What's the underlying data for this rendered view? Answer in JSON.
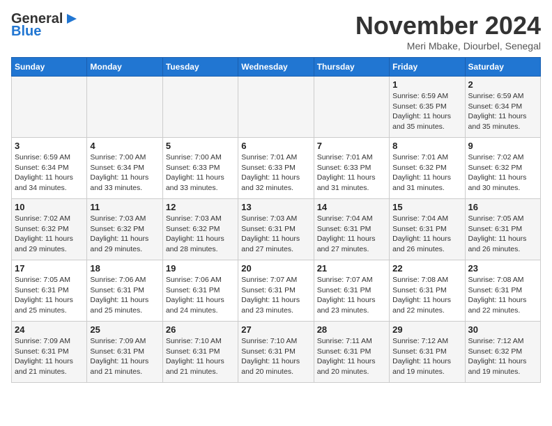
{
  "header": {
    "logo_general": "General",
    "logo_blue": "Blue",
    "month_title": "November 2024",
    "subtitle": "Meri Mbake, Diourbel, Senegal"
  },
  "days_of_week": [
    "Sunday",
    "Monday",
    "Tuesday",
    "Wednesday",
    "Thursday",
    "Friday",
    "Saturday"
  ],
  "weeks": [
    [
      {
        "day": "",
        "info": ""
      },
      {
        "day": "",
        "info": ""
      },
      {
        "day": "",
        "info": ""
      },
      {
        "day": "",
        "info": ""
      },
      {
        "day": "",
        "info": ""
      },
      {
        "day": "1",
        "info": "Sunrise: 6:59 AM\nSunset: 6:35 PM\nDaylight: 11 hours and 35 minutes."
      },
      {
        "day": "2",
        "info": "Sunrise: 6:59 AM\nSunset: 6:34 PM\nDaylight: 11 hours and 35 minutes."
      }
    ],
    [
      {
        "day": "3",
        "info": "Sunrise: 6:59 AM\nSunset: 6:34 PM\nDaylight: 11 hours and 34 minutes."
      },
      {
        "day": "4",
        "info": "Sunrise: 7:00 AM\nSunset: 6:34 PM\nDaylight: 11 hours and 33 minutes."
      },
      {
        "day": "5",
        "info": "Sunrise: 7:00 AM\nSunset: 6:33 PM\nDaylight: 11 hours and 33 minutes."
      },
      {
        "day": "6",
        "info": "Sunrise: 7:01 AM\nSunset: 6:33 PM\nDaylight: 11 hours and 32 minutes."
      },
      {
        "day": "7",
        "info": "Sunrise: 7:01 AM\nSunset: 6:33 PM\nDaylight: 11 hours and 31 minutes."
      },
      {
        "day": "8",
        "info": "Sunrise: 7:01 AM\nSunset: 6:32 PM\nDaylight: 11 hours and 31 minutes."
      },
      {
        "day": "9",
        "info": "Sunrise: 7:02 AM\nSunset: 6:32 PM\nDaylight: 11 hours and 30 minutes."
      }
    ],
    [
      {
        "day": "10",
        "info": "Sunrise: 7:02 AM\nSunset: 6:32 PM\nDaylight: 11 hours and 29 minutes."
      },
      {
        "day": "11",
        "info": "Sunrise: 7:03 AM\nSunset: 6:32 PM\nDaylight: 11 hours and 29 minutes."
      },
      {
        "day": "12",
        "info": "Sunrise: 7:03 AM\nSunset: 6:32 PM\nDaylight: 11 hours and 28 minutes."
      },
      {
        "day": "13",
        "info": "Sunrise: 7:03 AM\nSunset: 6:31 PM\nDaylight: 11 hours and 27 minutes."
      },
      {
        "day": "14",
        "info": "Sunrise: 7:04 AM\nSunset: 6:31 PM\nDaylight: 11 hours and 27 minutes."
      },
      {
        "day": "15",
        "info": "Sunrise: 7:04 AM\nSunset: 6:31 PM\nDaylight: 11 hours and 26 minutes."
      },
      {
        "day": "16",
        "info": "Sunrise: 7:05 AM\nSunset: 6:31 PM\nDaylight: 11 hours and 26 minutes."
      }
    ],
    [
      {
        "day": "17",
        "info": "Sunrise: 7:05 AM\nSunset: 6:31 PM\nDaylight: 11 hours and 25 minutes."
      },
      {
        "day": "18",
        "info": "Sunrise: 7:06 AM\nSunset: 6:31 PM\nDaylight: 11 hours and 25 minutes."
      },
      {
        "day": "19",
        "info": "Sunrise: 7:06 AM\nSunset: 6:31 PM\nDaylight: 11 hours and 24 minutes."
      },
      {
        "day": "20",
        "info": "Sunrise: 7:07 AM\nSunset: 6:31 PM\nDaylight: 11 hours and 23 minutes."
      },
      {
        "day": "21",
        "info": "Sunrise: 7:07 AM\nSunset: 6:31 PM\nDaylight: 11 hours and 23 minutes."
      },
      {
        "day": "22",
        "info": "Sunrise: 7:08 AM\nSunset: 6:31 PM\nDaylight: 11 hours and 22 minutes."
      },
      {
        "day": "23",
        "info": "Sunrise: 7:08 AM\nSunset: 6:31 PM\nDaylight: 11 hours and 22 minutes."
      }
    ],
    [
      {
        "day": "24",
        "info": "Sunrise: 7:09 AM\nSunset: 6:31 PM\nDaylight: 11 hours and 21 minutes."
      },
      {
        "day": "25",
        "info": "Sunrise: 7:09 AM\nSunset: 6:31 PM\nDaylight: 11 hours and 21 minutes."
      },
      {
        "day": "26",
        "info": "Sunrise: 7:10 AM\nSunset: 6:31 PM\nDaylight: 11 hours and 21 minutes."
      },
      {
        "day": "27",
        "info": "Sunrise: 7:10 AM\nSunset: 6:31 PM\nDaylight: 11 hours and 20 minutes."
      },
      {
        "day": "28",
        "info": "Sunrise: 7:11 AM\nSunset: 6:31 PM\nDaylight: 11 hours and 20 minutes."
      },
      {
        "day": "29",
        "info": "Sunrise: 7:12 AM\nSunset: 6:31 PM\nDaylight: 11 hours and 19 minutes."
      },
      {
        "day": "30",
        "info": "Sunrise: 7:12 AM\nSunset: 6:32 PM\nDaylight: 11 hours and 19 minutes."
      }
    ]
  ]
}
